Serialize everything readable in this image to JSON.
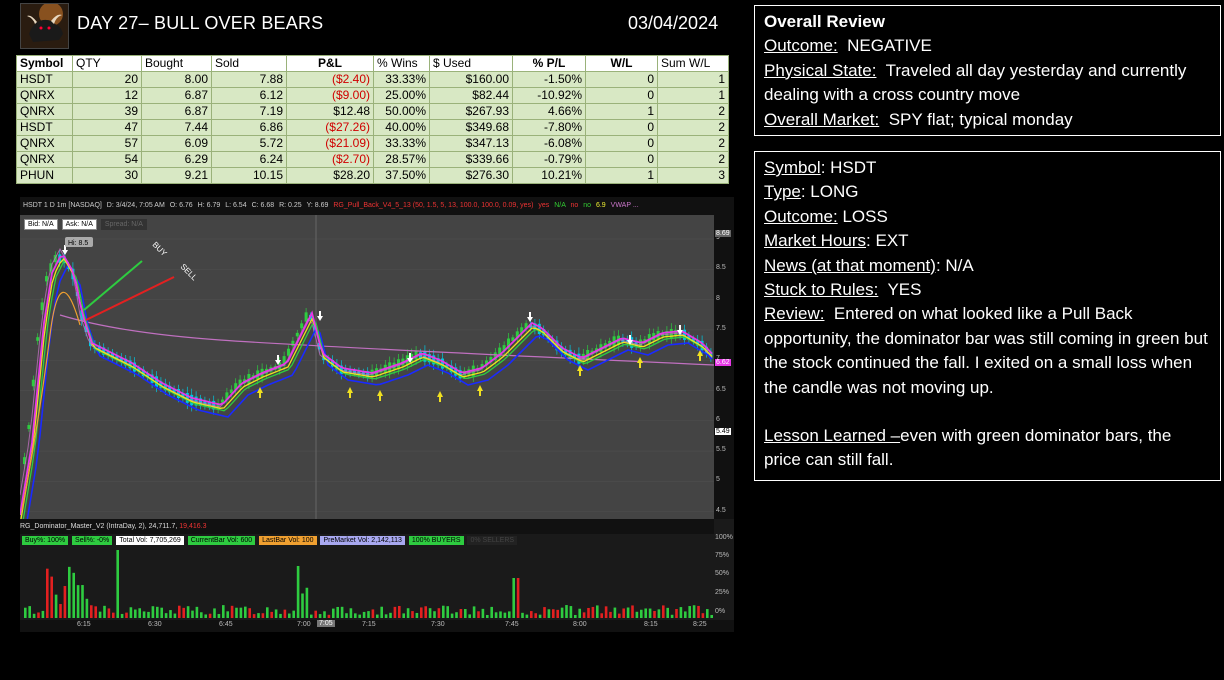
{
  "header": {
    "title": "DAY 27– BULL OVER BEARS",
    "date": "03/04/2024"
  },
  "trades": {
    "columns": [
      "Symbol",
      "QTY",
      "Bought",
      "Sold",
      "P&L",
      "% Wins",
      "$ Used",
      "% P/L",
      "W/L",
      "Sum W/L"
    ],
    "rows": [
      [
        "HSDT",
        "20",
        "8.00",
        "7.88",
        "($2.40)",
        "33.33%",
        "$160.00",
        "-1.50%",
        "0",
        "1"
      ],
      [
        "QNRX",
        "12",
        "6.87",
        "6.12",
        "($9.00)",
        "25.00%",
        "$82.44",
        "-10.92%",
        "0",
        "1"
      ],
      [
        "QNRX",
        "39",
        "6.87",
        "7.19",
        "$12.48",
        "50.00%",
        "$267.93",
        "4.66%",
        "1",
        "2"
      ],
      [
        "HSDT",
        "47",
        "7.44",
        "6.86",
        "($27.26)",
        "40.00%",
        "$349.68",
        "-7.80%",
        "0",
        "2"
      ],
      [
        "QNRX",
        "57",
        "6.09",
        "5.72",
        "($21.09)",
        "33.33%",
        "$347.13",
        "-6.08%",
        "0",
        "2"
      ],
      [
        "QNRX",
        "54",
        "6.29",
        "6.24",
        "($2.70)",
        "28.57%",
        "$339.66",
        "-0.79%",
        "0",
        "2"
      ],
      [
        "PHUN",
        "30",
        "9.21",
        "10.15",
        "$28.20",
        "37.50%",
        "$276.30",
        "10.21%",
        "1",
        "3"
      ]
    ]
  },
  "chart": {
    "header": {
      "symbol": "HSDT 1 D 1m [NASDAQ]",
      "datetime": "D: 3/4/24, 7:05 AM",
      "open": "O: 6.76",
      "high": "H: 6.79",
      "low": "L: 6.54",
      "close": "C: 6.68",
      "range": "R: 0.25",
      "y": "Y: 8.69",
      "study": "RG_Pull_Back_V4_5_13 (50, 1.5, 5, 13, 100.0, 100.0, 0.09, yes)",
      "flags": [
        "yes",
        "N/A",
        "no",
        "no",
        "6.9"
      ],
      "vwap": "VWAP ..."
    },
    "bid": "Bid: N/A",
    "ask": "Ask: N/A",
    "spread": "Spread: N/A",
    "hi_label": "Hi: 8.5",
    "buy_label": "BUY",
    "sell_label": "SELL",
    "price_ticks": [
      "9",
      "8.5",
      "8",
      "7.5",
      "7",
      "6.5",
      "6",
      "5.5",
      "5",
      "4.5"
    ],
    "price_tag_top": "8.69",
    "price_tag_mid": "5.49",
    "price_tag_last": "6.62",
    "volume_study": "RG_Dominator_Master_V2 (IntraDay, 2)",
    "volume_value": "24,711.7",
    "volume_value_red": "19,416.3",
    "badges": {
      "buy": "Buy%: 100%",
      "sell": "Sell%: -0%",
      "total": "Total Vol: 7,705,269",
      "current": "CurrentBar Vol: 600",
      "last": "LastBar Vol: 100",
      "premarket": "PreMarket Vol: 2,142,113",
      "buyers": "100% BUYERS",
      "sellers": "0% SELLERS"
    },
    "volume_ticks": [
      "100%",
      "75%",
      "50%",
      "25%",
      "0%"
    ],
    "time_ticks": [
      "6:15",
      "6:30",
      "6:45",
      "7:00",
      "7:05",
      "7:15",
      "7:30",
      "7:45",
      "8:00",
      "8:15",
      "8:25"
    ]
  },
  "overall_review": {
    "heading": "Overall Review",
    "outcome_label": "Outcome:",
    "outcome_value": "NEGATIVE",
    "physical_label": "Physical State:",
    "physical_value": "Traveled  all day yesterday and currently dealing with a cross country move",
    "market_label": "Overall Market:",
    "market_value": "SPY flat; typical monday"
  },
  "trade_review": {
    "symbol_label": "Symbol",
    "symbol_value": ": HSDT",
    "type_label": "Type",
    "type_value": ": LONG",
    "outcome_label": "Outcome:",
    "outcome_value": "LOSS",
    "hours_label": "Market Hours",
    "hours_value": ": EXT",
    "news_label": "News (at that moment)",
    "news_value": ": N/A",
    "rules_label": "Stuck to Rules:",
    "rules_value": "YES",
    "review_label": "Review:",
    "review_value": "Entered on what looked like a Pull Back opportunity, the dominator bar was still coming in green but the stock continued the fall.  I exited on a small loss when the candle was not moving up.",
    "lesson_label": "Lesson Learned –",
    "lesson_value": "even with green dominator bars, the price can still fall."
  },
  "colors": {
    "background": "#000000",
    "table_cell": "#d8e8c4",
    "negative": "#d00000",
    "candle_up": "#2ecc40",
    "candle_down": "#00c8e0",
    "ma_fast": "#e838e8",
    "ma_slow": "#1a2aff",
    "ma_mid": "#f0e020",
    "vwap": "#c070c0"
  }
}
